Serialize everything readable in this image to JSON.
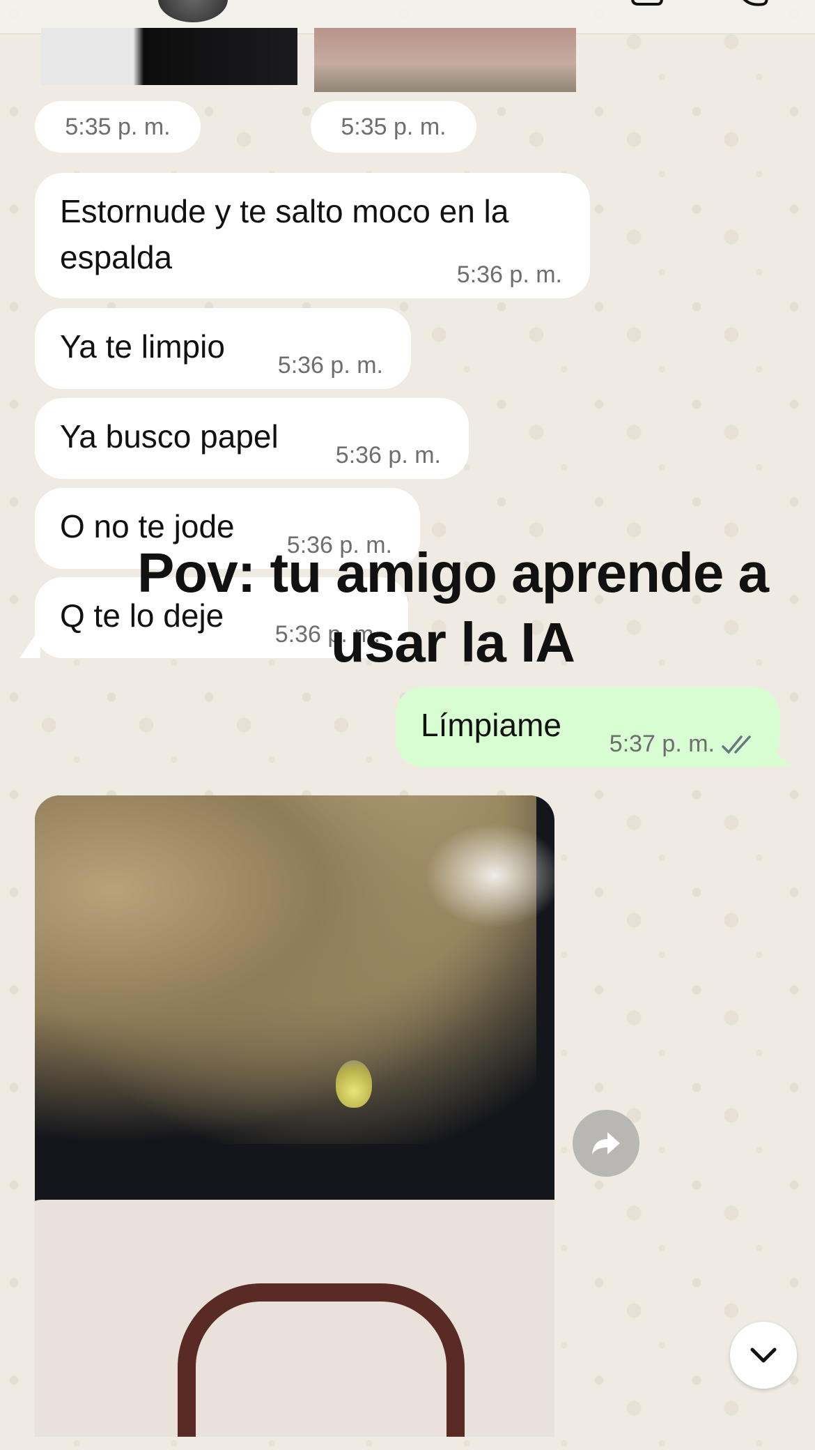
{
  "images": [
    {
      "time": "5:35 p. m."
    },
    {
      "time": "5:35 p. m."
    }
  ],
  "messages": [
    {
      "text": "Estornude y te salto moco en la espalda",
      "time": "5:36 p. m."
    },
    {
      "text": "Ya te limpio",
      "time": "5:36 p. m."
    },
    {
      "text": "Ya busco papel",
      "time": "5:36 p. m."
    },
    {
      "text": "O no te jode",
      "time": "5:36 p. m."
    },
    {
      "text": "Q te lo deje",
      "time": "5:36 p. m."
    }
  ],
  "outgoing": {
    "text": "Límpiame",
    "time": "5:37 p. m.",
    "status_icon": "double-check-icon"
  },
  "overlay": {
    "line1": "Pov: tu amigo aprende a",
    "line2": "usar la IA"
  },
  "icons": {
    "header": [
      "back-icon",
      "video-call-icon",
      "call-icon"
    ],
    "forward": "forward-icon",
    "scroll": "chevron-down-icon"
  },
  "colors": {
    "incoming_bubble": "#ffffff",
    "outgoing_bubble": "#d9fdd3",
    "wallpaper": "#efeae2",
    "time_text": "#6e6e6e"
  }
}
